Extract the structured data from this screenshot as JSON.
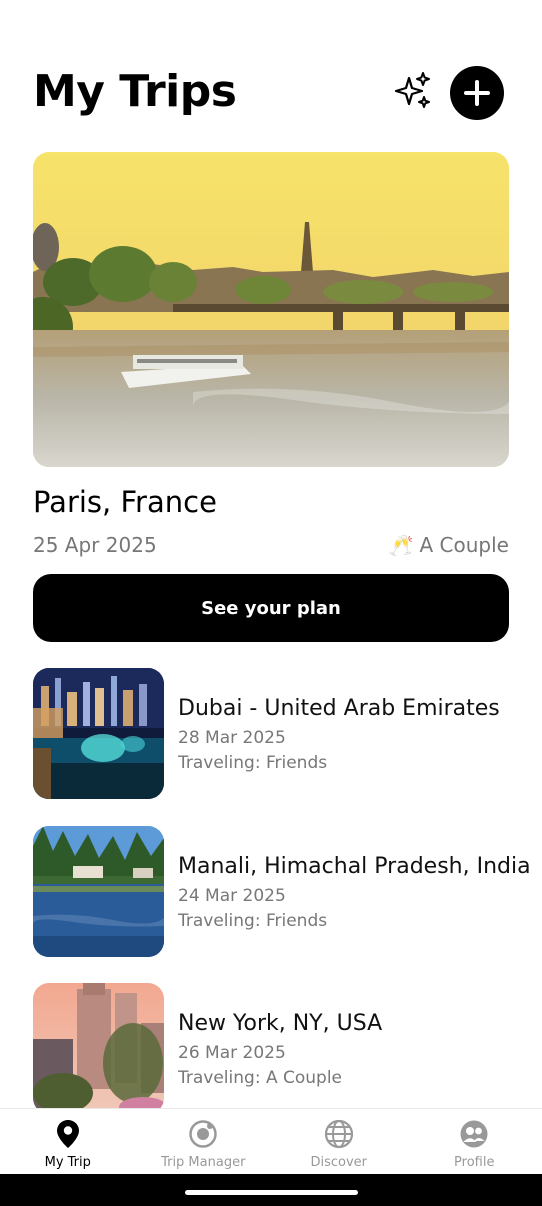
{
  "header": {
    "title": "My Trips",
    "sparkle_icon": "sparkles-icon",
    "add_icon": "plus-icon"
  },
  "featured_trip": {
    "image": "paris-seine-sunset",
    "destination": "Paris, France",
    "date": "25 Apr 2025",
    "companion_icon": "cheers-icon",
    "companion_glyph": "🥂",
    "companion": "A Couple",
    "button_label": "See your plan"
  },
  "trips": [
    {
      "image": "dubai-fountain-night",
      "name": "Dubai - United Arab Emirates",
      "date": "28 Mar 2025",
      "traveling": "Traveling: Friends"
    },
    {
      "image": "manali-lake-pines",
      "name": "Manali, Himachal Pradesh, India",
      "date": "24 Mar 2025",
      "traveling": "Traveling: Friends"
    },
    {
      "image": "new-york-central-park",
      "name": "New York, NY, USA",
      "date": "26 Mar 2025",
      "traveling": "Traveling: A Couple"
    }
  ],
  "bottom_nav": {
    "active": "My Trip",
    "items": [
      {
        "label": "My Trip",
        "icon": "map-pin-icon"
      },
      {
        "label": "Trip Manager",
        "icon": "radar-icon"
      },
      {
        "label": "Discover",
        "icon": "globe-icon"
      },
      {
        "label": "Profile",
        "icon": "profile-icon"
      }
    ]
  },
  "colors": {
    "primary": "#000000",
    "muted_text": "#777777",
    "nav_inactive": "#999999",
    "background": "#ffffff"
  }
}
